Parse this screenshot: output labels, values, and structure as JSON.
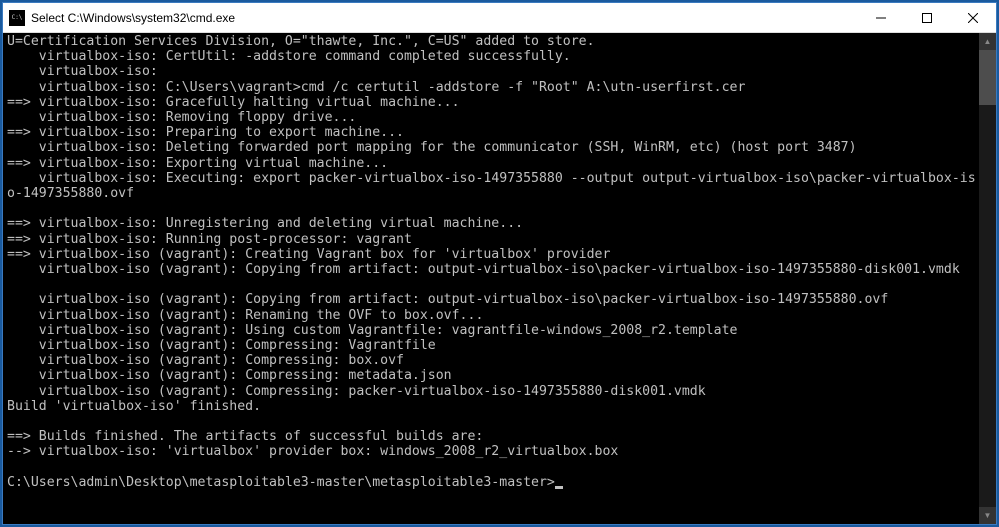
{
  "titlebar": {
    "icon_label": "C:\\",
    "title": "Select C:\\Windows\\system32\\cmd.exe"
  },
  "terminal": {
    "lines": [
      "U=Certification Services Division, O=\"thawte, Inc.\", C=US\" added to store.",
      "    virtualbox-iso: CertUtil: -addstore command completed successfully.",
      "    virtualbox-iso:",
      "    virtualbox-iso: C:\\Users\\vagrant>cmd /c certutil -addstore -f \"Root\" A:\\utn-userfirst.cer",
      "==> virtualbox-iso: Gracefully halting virtual machine...",
      "    virtualbox-iso: Removing floppy drive...",
      "==> virtualbox-iso: Preparing to export machine...",
      "    virtualbox-iso: Deleting forwarded port mapping for the communicator (SSH, WinRM, etc) (host port 3487)",
      "==> virtualbox-iso: Exporting virtual machine...",
      "    virtualbox-iso: Executing: export packer-virtualbox-iso-1497355880 --output output-virtualbox-iso\\packer-virtualbox-iso-1497355880.ovf",
      "",
      "==> virtualbox-iso: Unregistering and deleting virtual machine...",
      "==> virtualbox-iso: Running post-processor: vagrant",
      "==> virtualbox-iso (vagrant): Creating Vagrant box for 'virtualbox' provider",
      "    virtualbox-iso (vagrant): Copying from artifact: output-virtualbox-iso\\packer-virtualbox-iso-1497355880-disk001.vmdk",
      "",
      "    virtualbox-iso (vagrant): Copying from artifact: output-virtualbox-iso\\packer-virtualbox-iso-1497355880.ovf",
      "    virtualbox-iso (vagrant): Renaming the OVF to box.ovf...",
      "    virtualbox-iso (vagrant): Using custom Vagrantfile: vagrantfile-windows_2008_r2.template",
      "    virtualbox-iso (vagrant): Compressing: Vagrantfile",
      "    virtualbox-iso (vagrant): Compressing: box.ovf",
      "    virtualbox-iso (vagrant): Compressing: metadata.json",
      "    virtualbox-iso (vagrant): Compressing: packer-virtualbox-iso-1497355880-disk001.vmdk",
      "Build 'virtualbox-iso' finished.",
      "",
      "==> Builds finished. The artifacts of successful builds are:",
      "--> virtualbox-iso: 'virtualbox' provider box: windows_2008_r2_virtualbox.box",
      ""
    ],
    "prompt": "C:\\Users\\admin\\Desktop\\metasploitable3-master\\metasploitable3-master>"
  }
}
